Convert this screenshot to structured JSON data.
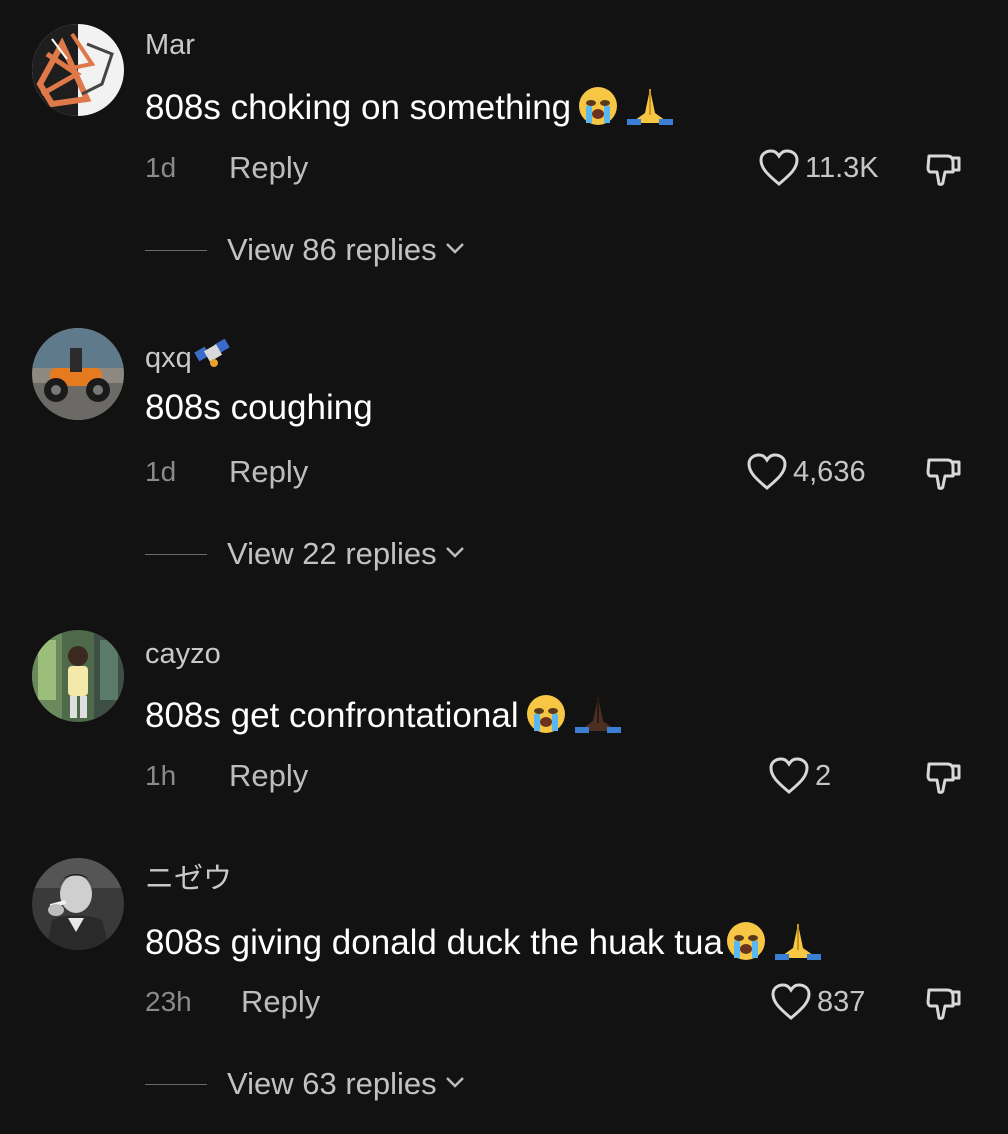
{
  "comments": [
    {
      "username": "Mar",
      "text": "808s choking on something",
      "emojis": [
        "loudly-crying-face",
        "folded-hands"
      ],
      "time": "1d",
      "reply_label": "Reply",
      "likes": "11.3K",
      "view_replies": "View 86 replies"
    },
    {
      "username": "qxq",
      "username_icon": "satellite-icon",
      "text": "808s coughing",
      "emojis": [],
      "time": "1d",
      "reply_label": "Reply",
      "likes": "4,636",
      "view_replies": "View 22 replies"
    },
    {
      "username": "cayzo",
      "text": "808s get confrontational",
      "emojis": [
        "loudly-crying-face",
        "folded-hands-dark-skin"
      ],
      "time": "1h",
      "reply_label": "Reply",
      "likes": "2",
      "view_replies": ""
    },
    {
      "username": "ニゼウ",
      "text": "808s giving donald duck the huak tua",
      "emojis": [
        "loudly-crying-face",
        "folded-hands"
      ],
      "time": "23h",
      "reply_label": "Reply",
      "likes": "837",
      "view_replies": "View 63 replies"
    }
  ],
  "colors": {
    "background": "#121212",
    "primary_text": "#ffffff",
    "secondary_text": "#8a8a8a"
  }
}
